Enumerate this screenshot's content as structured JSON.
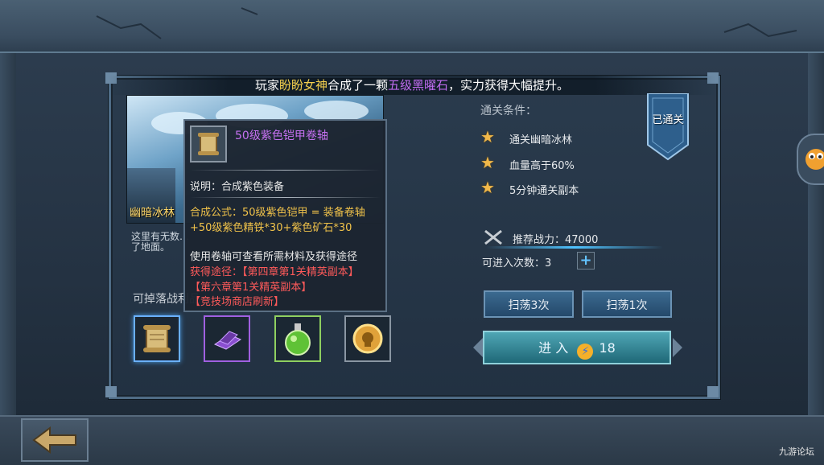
{
  "banner": {
    "prefix": "玩家",
    "player": "盼盼女神",
    "middle": "合成了一颗",
    "item": "五级黑曜石",
    "suffix": "，实力获得大幅提升。"
  },
  "stage": {
    "name": "幽暗冰林",
    "description": "这里有无数…了地面。",
    "drops_label": "可掉落战利品",
    "drops": [
      {
        "icon": "scroll-icon",
        "rarity_color": "#6ab0ff"
      },
      {
        "icon": "purple-crystal-icon",
        "rarity_color": "#a060e0"
      },
      {
        "icon": "green-potion-icon",
        "rarity_color": "#8fd060"
      },
      {
        "icon": "gold-coin-icon",
        "rarity_color": "#8a96a3"
      }
    ]
  },
  "tooltip": {
    "title": "50级紫色铠甲卷轴",
    "description": "说明：合成紫色装备",
    "formula_line1": "合成公式：50级紫色铠甲 = 装备卷轴",
    "formula_line2": "+50级紫色精铁*30+紫色矿石*30",
    "hint": "使用卷轴可查看所需材料及获得途径",
    "source_label": "获得途径：",
    "sources": [
      "【第四章第1关精英副本】",
      "【第六章第1关精英副本】",
      "【竞技场商店刷新】"
    ]
  },
  "conditions": {
    "title": "通关条件：",
    "items": [
      "通关幽暗冰林",
      "血量高于60%",
      "5分钟通关副本"
    ],
    "cleared_badge": "已通关"
  },
  "power": {
    "label": "推荐战力：",
    "value": "47000"
  },
  "entries": {
    "label": "可进入次数：",
    "value": "3"
  },
  "buttons": {
    "sweep3": "扫荡3次",
    "sweep1": "扫荡1次",
    "enter": "进 入",
    "enter_cost": "18"
  },
  "watermark": "九游论坛"
}
